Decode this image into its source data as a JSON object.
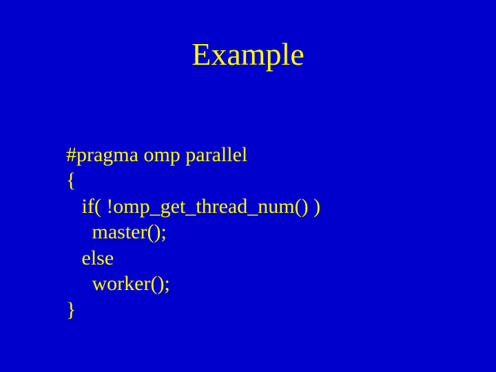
{
  "title": "Example",
  "code": {
    "l1": "#pragma omp parallel",
    "l2": "{",
    "l3": "   if( !omp_get_thread_num() )",
    "l4": "     master();",
    "l5": "   else",
    "l6": "     worker();",
    "l7": "}"
  }
}
